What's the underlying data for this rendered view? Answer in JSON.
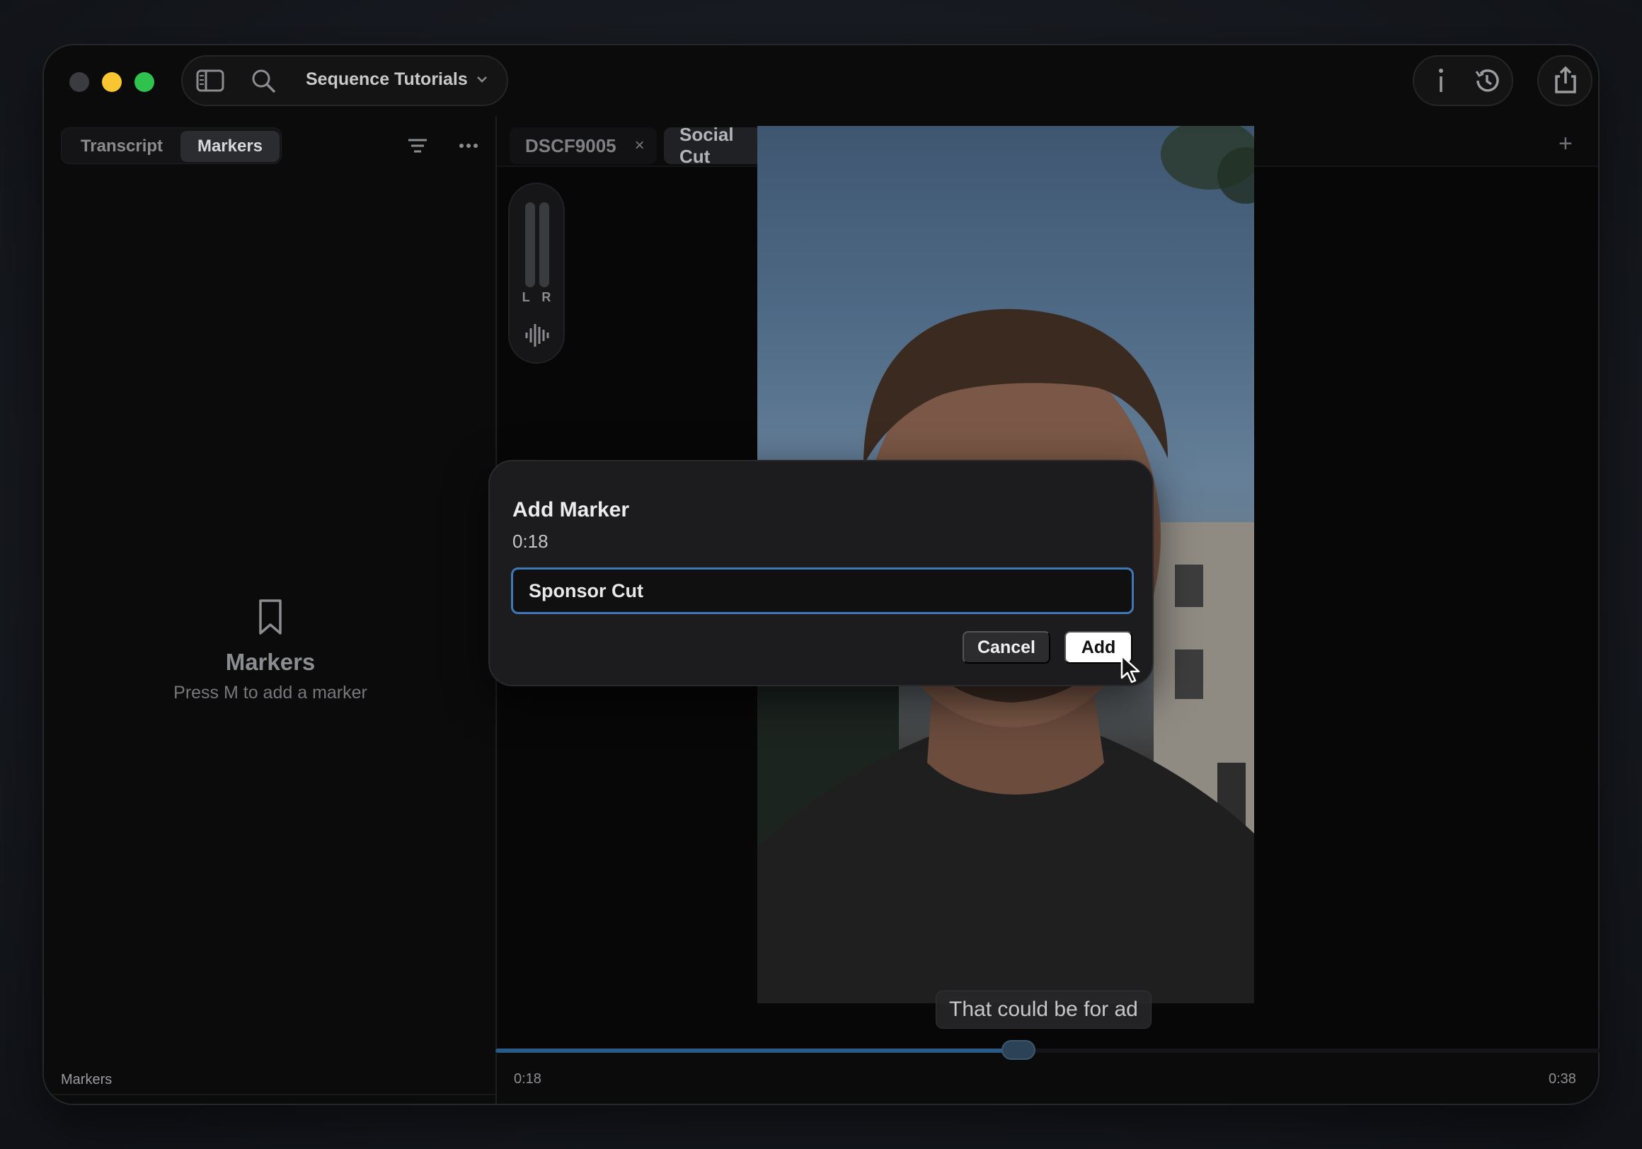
{
  "window": {
    "project_title": "Sequence Tutorials"
  },
  "left_panel": {
    "tabs": [
      {
        "label": "Transcript",
        "active": false
      },
      {
        "label": "Markers",
        "active": true
      }
    ],
    "empty_state": {
      "title": "Markers",
      "subtitle": "Press M to add a marker"
    },
    "footer_label": "Markers"
  },
  "editor_tabs": [
    {
      "label": "DSCF9005",
      "close": "×"
    },
    {
      "label": "Social Cut",
      "close": "×"
    }
  ],
  "add_tab_label": "+",
  "audio_meter": {
    "label": "L R"
  },
  "viewer": {
    "caption": "That could be for ad"
  },
  "timeline": {
    "current_time": "0:18",
    "duration": "0:38",
    "progress": 0.474
  },
  "dialog": {
    "title": "Add Marker",
    "time": "0:18",
    "input_value": "Sponsor Cut",
    "cancel_label": "Cancel",
    "add_label": "Add"
  },
  "colors": {
    "accent": "#3e78b8",
    "close": "#3b3c40",
    "minimize": "#f7c631",
    "maximize": "#2fc34d"
  }
}
